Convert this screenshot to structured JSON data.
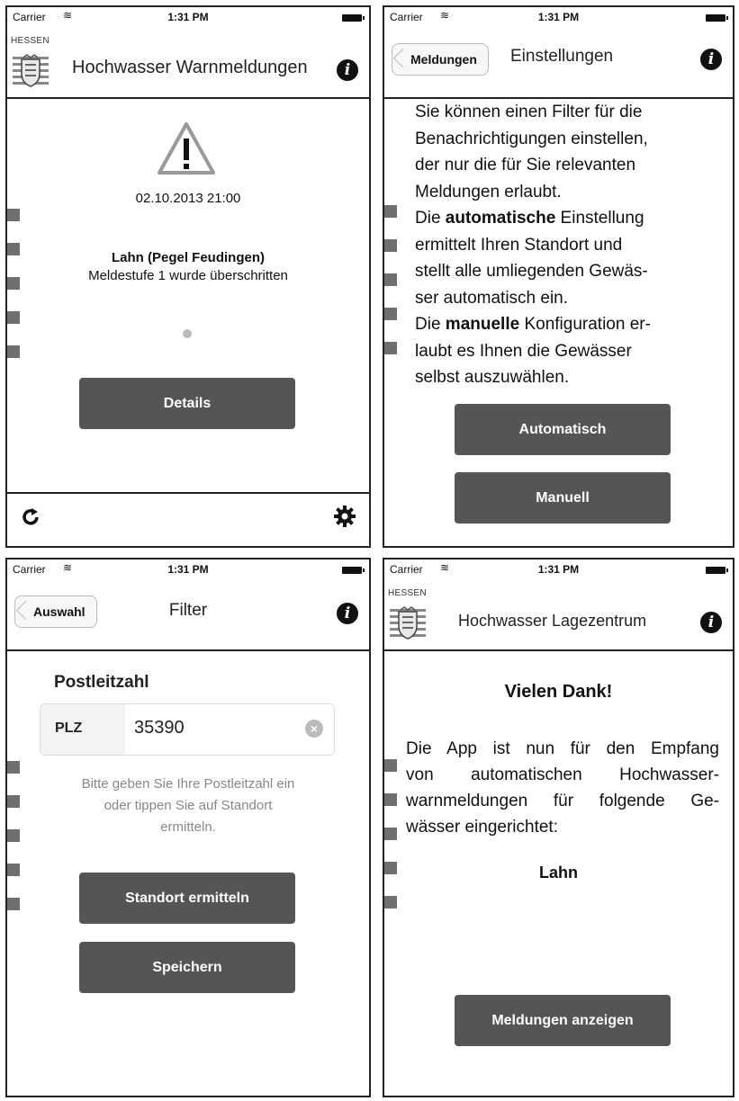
{
  "status_bar": {
    "carrier": "Carrier",
    "time": "1:31 PM"
  },
  "panel1": {
    "hessen_label": "HESSEN",
    "title": "Hochwasser Warnmeldungen",
    "date": "02.10.2013 21:00",
    "station": "Lahn (Pegel Feudingen)",
    "message": "Meldestufe 1 wurde überschritten",
    "details_button": "Details",
    "warning_icon": "warning-triangle-icon",
    "refresh_icon": "refresh-icon",
    "settings_icon": "gear-icon"
  },
  "panel2": {
    "back_label": "Meldungen",
    "title": "Einstellungen",
    "text_lines": {
      "l1": "Sie können einen Filter für die",
      "l2": "Benachrichtigungen einstellen,",
      "l3": "der nur die für Sie relevanten",
      "l4": "Meldungen erlaubt.",
      "l5_pre": "Die ",
      "l5_bold": "automatische",
      "l5_post": " Einstellung",
      "l6": "ermittelt Ihren Standort und",
      "l7": "stellt alle umliegenden Gewäs-",
      "l8": "ser automatisch ein.",
      "l9_pre": "Die ",
      "l9_bold": "manuelle",
      "l9_post": " Konfiguration er-",
      "l10": "laubt es Ihnen die Gewässer",
      "l11": "selbst auszuwählen."
    },
    "auto_button": "Automatisch",
    "manual_button": "Manuell"
  },
  "panel3": {
    "back_label": "Auswahl",
    "title": "Filter",
    "section_label": "Postleitzahl",
    "field_label": "PLZ",
    "field_value": "35390",
    "hint_l1": "Bitte geben Sie Ihre Postleitzahl ein",
    "hint_l2": "oder tippen Sie auf Standort",
    "hint_l3": "ermitteln.",
    "locate_button": "Standort ermitteln",
    "save_button": "Speichern"
  },
  "panel4": {
    "hessen_label": "HESSEN",
    "title": "Hochwasser Lagezentrum",
    "heading": "Vielen Dank!",
    "text_l1": "Die App ist nun für den Empfang",
    "text_l2": "von automatischen Hochwasser-",
    "text_l3": "warnmeldungen für folgende Ge-",
    "text_l4": "wässer eingerichtet:",
    "river": "Lahn",
    "show_button": "Meldungen anzeigen"
  }
}
